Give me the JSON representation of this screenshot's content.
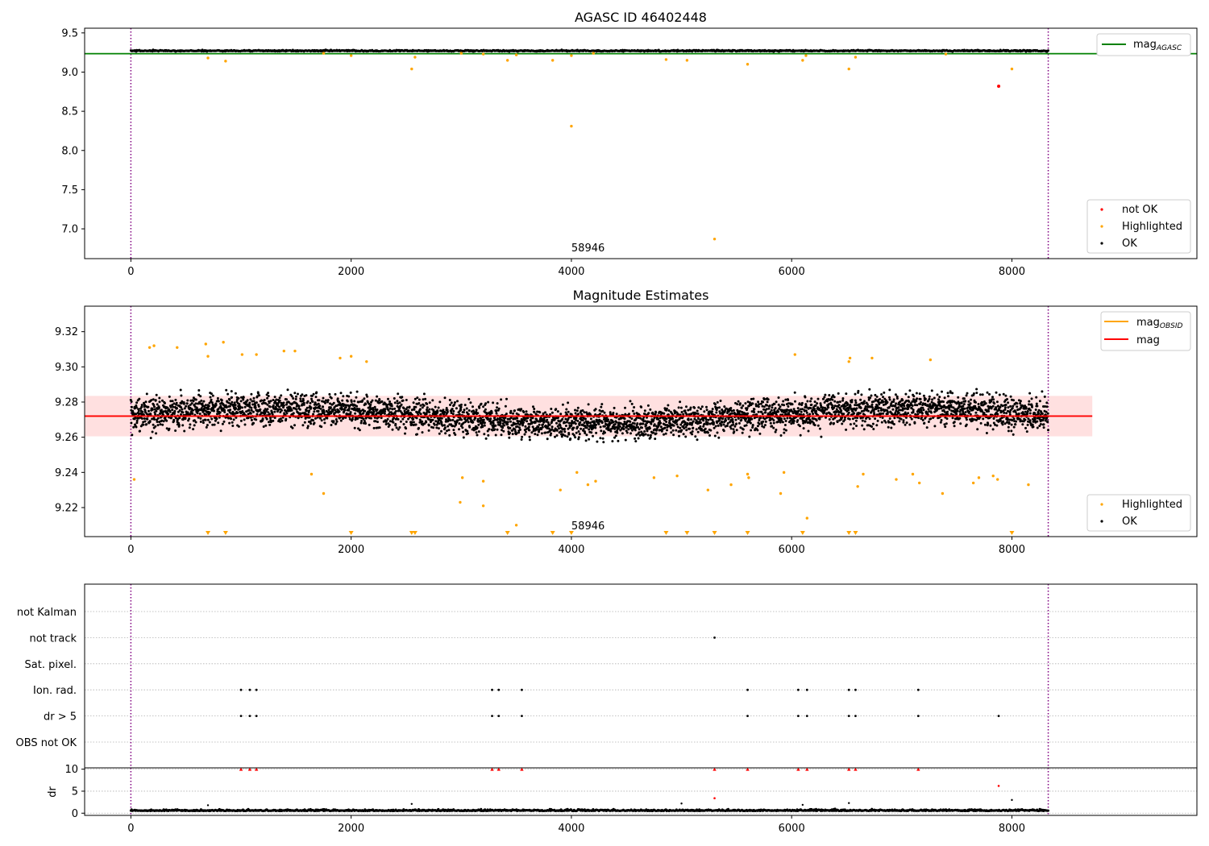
{
  "chart_data": [
    {
      "id": "top",
      "type": "scatter",
      "title": "AGASC ID 46402448",
      "xlim": [
        -420,
        9680
      ],
      "ylim": [
        6.62,
        9.56
      ],
      "xticks": [
        0,
        2000,
        4000,
        6000,
        8000
      ],
      "yticks": [
        7.0,
        7.5,
        8.0,
        8.5,
        9.0,
        9.5
      ],
      "ytick_labels": [
        "7.0",
        "7.5",
        "8.0",
        "8.5",
        "9.0",
        "9.5"
      ],
      "vlines": [
        0,
        8330
      ],
      "annotation": {
        "text": "58946",
        "x": 4000
      },
      "hline": {
        "name": "mag_AGASC",
        "y": 9.235,
        "color": "#008000"
      },
      "ok_band": {
        "center": 9.272,
        "spread": 0.009
      },
      "highlighted": [
        {
          "x": 700,
          "y": 9.18
        },
        {
          "x": 860,
          "y": 9.14
        },
        {
          "x": 1750,
          "y": 9.24
        },
        {
          "x": 2000,
          "y": 9.21
        },
        {
          "x": 2550,
          "y": 9.04
        },
        {
          "x": 2580,
          "y": 9.19
        },
        {
          "x": 3000,
          "y": 9.24
        },
        {
          "x": 3200,
          "y": 9.23
        },
        {
          "x": 3420,
          "y": 9.15
        },
        {
          "x": 3500,
          "y": 9.22
        },
        {
          "x": 3830,
          "y": 9.15
        },
        {
          "x": 4000,
          "y": 8.31
        },
        {
          "x": 4000,
          "y": 9.21
        },
        {
          "x": 4200,
          "y": 9.24
        },
        {
          "x": 4860,
          "y": 9.16
        },
        {
          "x": 5050,
          "y": 9.15
        },
        {
          "x": 5300,
          "y": 6.87
        },
        {
          "x": 5600,
          "y": 9.1
        },
        {
          "x": 6100,
          "y": 9.15
        },
        {
          "x": 6130,
          "y": 9.21
        },
        {
          "x": 6520,
          "y": 9.04
        },
        {
          "x": 6580,
          "y": 9.19
        },
        {
          "x": 7400,
          "y": 9.23
        },
        {
          "x": 8000,
          "y": 9.04
        }
      ],
      "not_ok": [
        {
          "x": 7880,
          "y": 8.82
        }
      ],
      "legends": [
        {
          "position": "upper-right",
          "items": [
            {
              "label_main": "mag",
              "label_sub": "AGASC",
              "kind": "line",
              "color": "#008000"
            }
          ]
        },
        {
          "position": "lower-right",
          "items": [
            {
              "label": "not OK",
              "kind": "dot",
              "color": "#ff0000"
            },
            {
              "label": "Highlighted",
              "kind": "dot",
              "color": "#ffa500"
            },
            {
              "label": "OK",
              "kind": "dot",
              "color": "#000000"
            }
          ]
        }
      ]
    },
    {
      "id": "mid",
      "type": "scatter",
      "title": "Magnitude Estimates",
      "xlim": [
        -420,
        9680
      ],
      "ylim": [
        9.2035,
        9.3345
      ],
      "xticks": [
        0,
        2000,
        4000,
        6000,
        8000
      ],
      "yticks": [
        9.22,
        9.24,
        9.26,
        9.28,
        9.3,
        9.32
      ],
      "ytick_labels": [
        "9.22",
        "9.24",
        "9.26",
        "9.28",
        "9.30",
        "9.32"
      ],
      "vlines": [
        0,
        8330
      ],
      "annotation": {
        "text": "58946",
        "x": 4000
      },
      "mag_line": {
        "name": "mag",
        "y": 9.272,
        "band": [
          9.2605,
          9.2835
        ],
        "x_end": 8730,
        "color": "#ff0000"
      },
      "mag_obsid": {
        "name": "mag_OBSID",
        "y": 9.272,
        "color": "#ffa500"
      },
      "ok_band": {
        "center": 9.272,
        "spread": 0.009
      },
      "highlighted": [
        {
          "x": 30,
          "y": 9.236
        },
        {
          "x": 170,
          "y": 9.311
        },
        {
          "x": 210,
          "y": 9.312
        },
        {
          "x": 420,
          "y": 9.311
        },
        {
          "x": 680,
          "y": 9.313
        },
        {
          "x": 700,
          "y": 9.306
        },
        {
          "x": 840,
          "y": 9.314
        },
        {
          "x": 1010,
          "y": 9.307
        },
        {
          "x": 1140,
          "y": 9.307
        },
        {
          "x": 1390,
          "y": 9.309
        },
        {
          "x": 1490,
          "y": 9.309
        },
        {
          "x": 1640,
          "y": 9.239
        },
        {
          "x": 1750,
          "y": 9.228
        },
        {
          "x": 1900,
          "y": 9.305
        },
        {
          "x": 2000,
          "y": 9.306
        },
        {
          "x": 2140,
          "y": 9.303
        },
        {
          "x": 2990,
          "y": 9.223
        },
        {
          "x": 3010,
          "y": 9.237
        },
        {
          "x": 3200,
          "y": 9.235
        },
        {
          "x": 3200,
          "y": 9.221
        },
        {
          "x": 3500,
          "y": 9.21
        },
        {
          "x": 3900,
          "y": 9.23
        },
        {
          "x": 4050,
          "y": 9.24
        },
        {
          "x": 4150,
          "y": 9.233
        },
        {
          "x": 4220,
          "y": 9.235
        },
        {
          "x": 4750,
          "y": 9.237
        },
        {
          "x": 4960,
          "y": 9.238
        },
        {
          "x": 5240,
          "y": 9.23
        },
        {
          "x": 5450,
          "y": 9.233
        },
        {
          "x": 5600,
          "y": 9.239
        },
        {
          "x": 5610,
          "y": 9.237
        },
        {
          "x": 5900,
          "y": 9.228
        },
        {
          "x": 5930,
          "y": 9.24
        },
        {
          "x": 6030,
          "y": 9.307
        },
        {
          "x": 6140,
          "y": 9.214
        },
        {
          "x": 6520,
          "y": 9.303
        },
        {
          "x": 6530,
          "y": 9.305
        },
        {
          "x": 6600,
          "y": 9.232
        },
        {
          "x": 6650,
          "y": 9.239
        },
        {
          "x": 6730,
          "y": 9.305
        },
        {
          "x": 6950,
          "y": 9.236
        },
        {
          "x": 7100,
          "y": 9.239
        },
        {
          "x": 7160,
          "y": 9.234
        },
        {
          "x": 7260,
          "y": 9.304
        },
        {
          "x": 7370,
          "y": 9.228
        },
        {
          "x": 7650,
          "y": 9.234
        },
        {
          "x": 7700,
          "y": 9.237
        },
        {
          "x": 7830,
          "y": 9.238
        },
        {
          "x": 7870,
          "y": 9.236
        },
        {
          "x": 8150,
          "y": 9.233
        }
      ],
      "offscale_below": [
        700,
        860,
        2000,
        2550,
        2580,
        3420,
        3830,
        4000,
        4860,
        5050,
        5300,
        5600,
        6100,
        6520,
        6580,
        8000
      ],
      "legends": [
        {
          "position": "upper-right",
          "items": [
            {
              "label_main": "mag",
              "label_sub": "OBSID",
              "kind": "line",
              "color": "#ffa500"
            },
            {
              "label": "mag",
              "kind": "line",
              "color": "#ff0000"
            }
          ]
        },
        {
          "position": "lower-right",
          "items": [
            {
              "label": "Highlighted",
              "kind": "dot",
              "color": "#ffa500"
            },
            {
              "label": "OK",
              "kind": "dot",
              "color": "#000000"
            }
          ]
        }
      ]
    },
    {
      "id": "flags",
      "type": "scatter",
      "xlim": [
        -420,
        9680
      ],
      "categories": [
        "not Kalman",
        "not track",
        "Sat. pixel.",
        "Ion. rad.",
        "dr > 5",
        "OBS not OK"
      ],
      "vlines": [
        0,
        8330
      ],
      "points": {
        "not Kalman": [],
        "not track": [
          5300
        ],
        "Sat. pixel.": [],
        "Ion. rad.": [
          1000,
          1080,
          1140,
          3280,
          3340,
          3550,
          5600,
          6060,
          6140,
          6520,
          6580,
          7150
        ],
        "dr > 5": [
          1000,
          1080,
          1140,
          3280,
          3340,
          3550,
          5600,
          6060,
          6140,
          6520,
          6580,
          7150,
          7880
        ],
        "OBS not OK": []
      }
    },
    {
      "id": "dr",
      "type": "scatter",
      "ylabel": "dr",
      "xlim": [
        -420,
        9680
      ],
      "ylim": [
        -0.5,
        10.3
      ],
      "xticks": [
        0,
        2000,
        4000,
        6000,
        8000
      ],
      "yticks": [
        0,
        5,
        10
      ],
      "ytick_labels": [
        "0",
        "5",
        "10"
      ],
      "vlines": [
        0,
        8330
      ],
      "ok_band": {
        "center": 0.5,
        "spread": 0.3
      },
      "capped": [
        1000,
        1080,
        1140,
        3280,
        3340,
        3550,
        5300,
        5600,
        6060,
        6140,
        6520,
        6580,
        7150
      ],
      "not_ok": [
        {
          "x": 7880,
          "y": 6.2
        },
        {
          "x": 5300,
          "y": 3.4
        }
      ],
      "ok_outliers": [
        {
          "x": 700,
          "y": 1.8
        },
        {
          "x": 2550,
          "y": 2.1
        },
        {
          "x": 5000,
          "y": 2.2
        },
        {
          "x": 6520,
          "y": 2.3
        },
        {
          "x": 8000,
          "y": 3.0
        },
        {
          "x": 6100,
          "y": 1.9
        }
      ]
    }
  ]
}
